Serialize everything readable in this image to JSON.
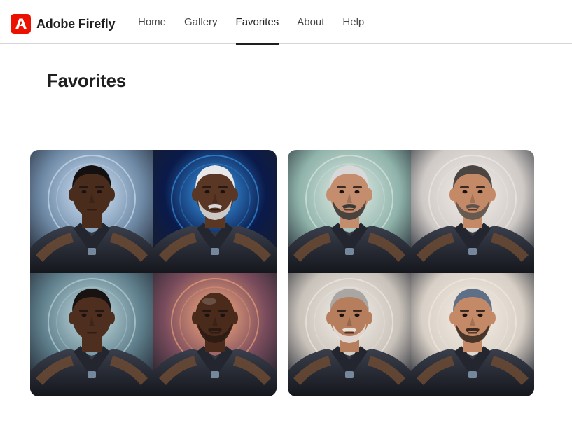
{
  "app": {
    "name": "Adobe Firefly",
    "logo_icon": "adobe-logo-icon",
    "brand_color": "#eb1000"
  },
  "nav": {
    "items": [
      {
        "label": "Home",
        "active": false
      },
      {
        "label": "Gallery",
        "active": false
      },
      {
        "label": "Favorites",
        "active": true
      },
      {
        "label": "About",
        "active": false
      },
      {
        "label": "Help",
        "active": false
      }
    ]
  },
  "page": {
    "title": "Favorites"
  },
  "favorites": [
    {
      "images": [
        {
          "subject": "portrait-dark-hair-young",
          "bg": "#6f8aa6",
          "glow": "#d9ecff",
          "skin": "#4a2c1c",
          "hair": "#151010",
          "beard": "none"
        },
        {
          "subject": "portrait-white-hair-beard",
          "bg": "#0a1a4a",
          "glow": "#3ea8ff",
          "skin": "#5a3624",
          "hair": "#e8e8e8",
          "beard": "#d8d8d8"
        },
        {
          "subject": "portrait-dark-hair-older",
          "bg": "#5f7f8c",
          "glow": "#c9e2e6",
          "skin": "#4e2e1f",
          "hair": "#181210",
          "beard": "none"
        },
        {
          "subject": "portrait-bald-beard",
          "bg": "#7a4c5c",
          "glow": "#ffb080",
          "skin": "#4a2a1a",
          "hair": "none",
          "beard": "#2a1a14"
        }
      ]
    },
    {
      "images": [
        {
          "subject": "portrait-silver-hair-goatee",
          "bg": "#8fb3aa",
          "glow": "#e6f0ea",
          "skin": "#c48e6e",
          "hair": "#d8d8d8",
          "beard": "#3c3a38"
        },
        {
          "subject": "portrait-gray-hair-stubble",
          "bg": "#cfcac6",
          "glow": "#f4efec",
          "skin": "#c48a68",
          "hair": "#4a4540",
          "beard": "#5e544c"
        },
        {
          "subject": "portrait-gray-hair-white-beard",
          "bg": "#c9c2ba",
          "glow": "#f4f0ea",
          "skin": "#b77e5e",
          "hair": "#a9a6a3",
          "beard": "#e4e0dc"
        },
        {
          "subject": "portrait-headset-mustache",
          "bg": "#d8d0c6",
          "glow": "#f6efe6",
          "skin": "#c48a68",
          "hair": "#5e6f88",
          "beard": "#3a2a22"
        }
      ]
    }
  ]
}
